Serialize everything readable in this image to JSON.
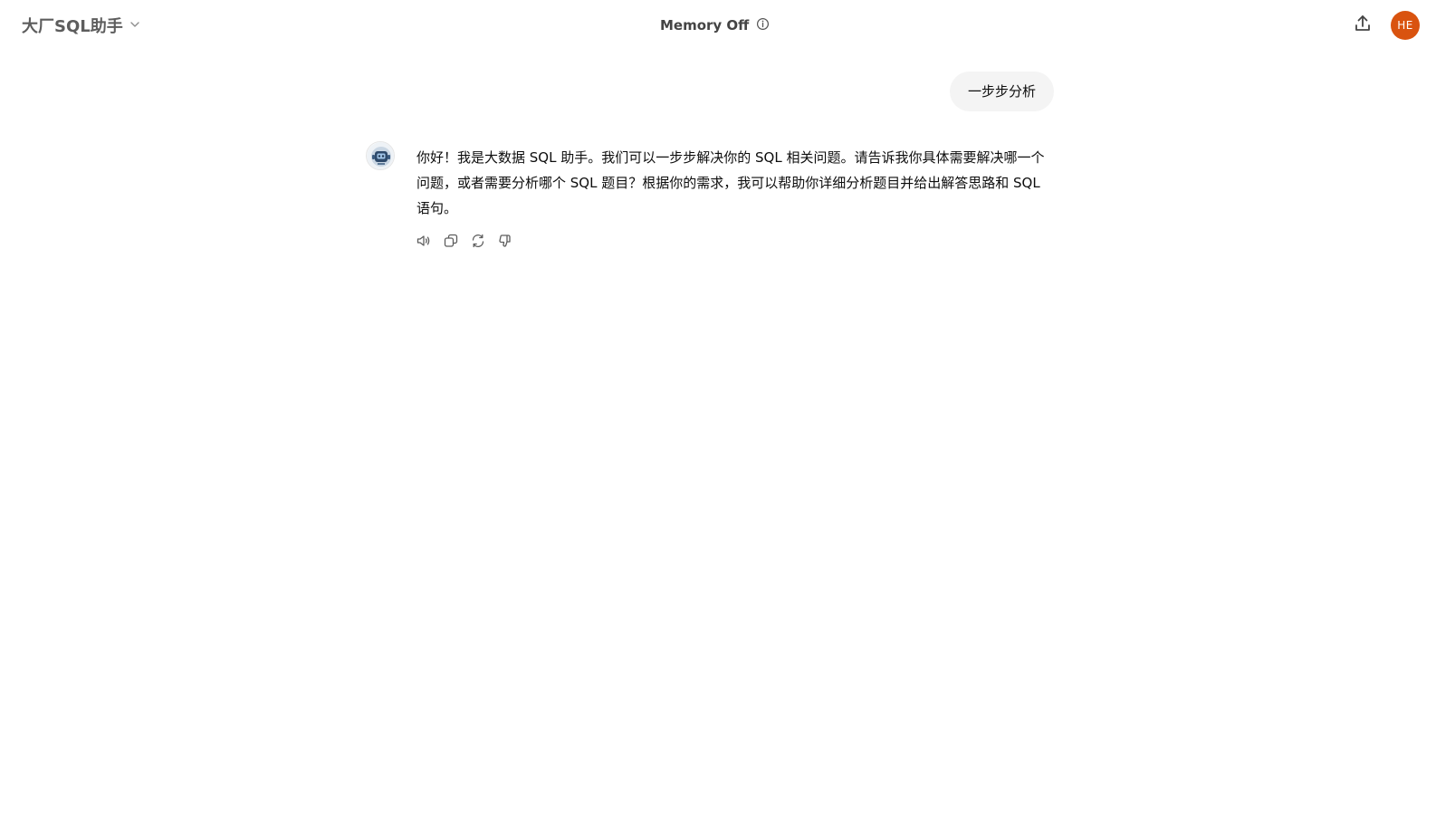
{
  "header": {
    "model_name": "大厂SQL助手",
    "memory_status": "Memory Off",
    "avatar_initials": "HE",
    "avatar_color": "#d9530f"
  },
  "conversation": {
    "user_message": "一步步分析",
    "assistant_message": "你好！我是大数据 SQL 助手。我们可以一步步解决你的 SQL 相关问题。请告诉我你具体需要解决哪一个问题，或者需要分析哪个 SQL 题目？根据你的需求，我可以帮助你详细分析题目并给出解答思路和 SQL 语句。"
  },
  "icons": {
    "model_chevron": "chevron-down-icon",
    "memory_info": "info-icon",
    "share": "share-upload-icon",
    "read_aloud": "speaker-icon",
    "copy": "copy-icon",
    "regenerate": "refresh-icon",
    "dislike": "thumbs-down-icon"
  }
}
